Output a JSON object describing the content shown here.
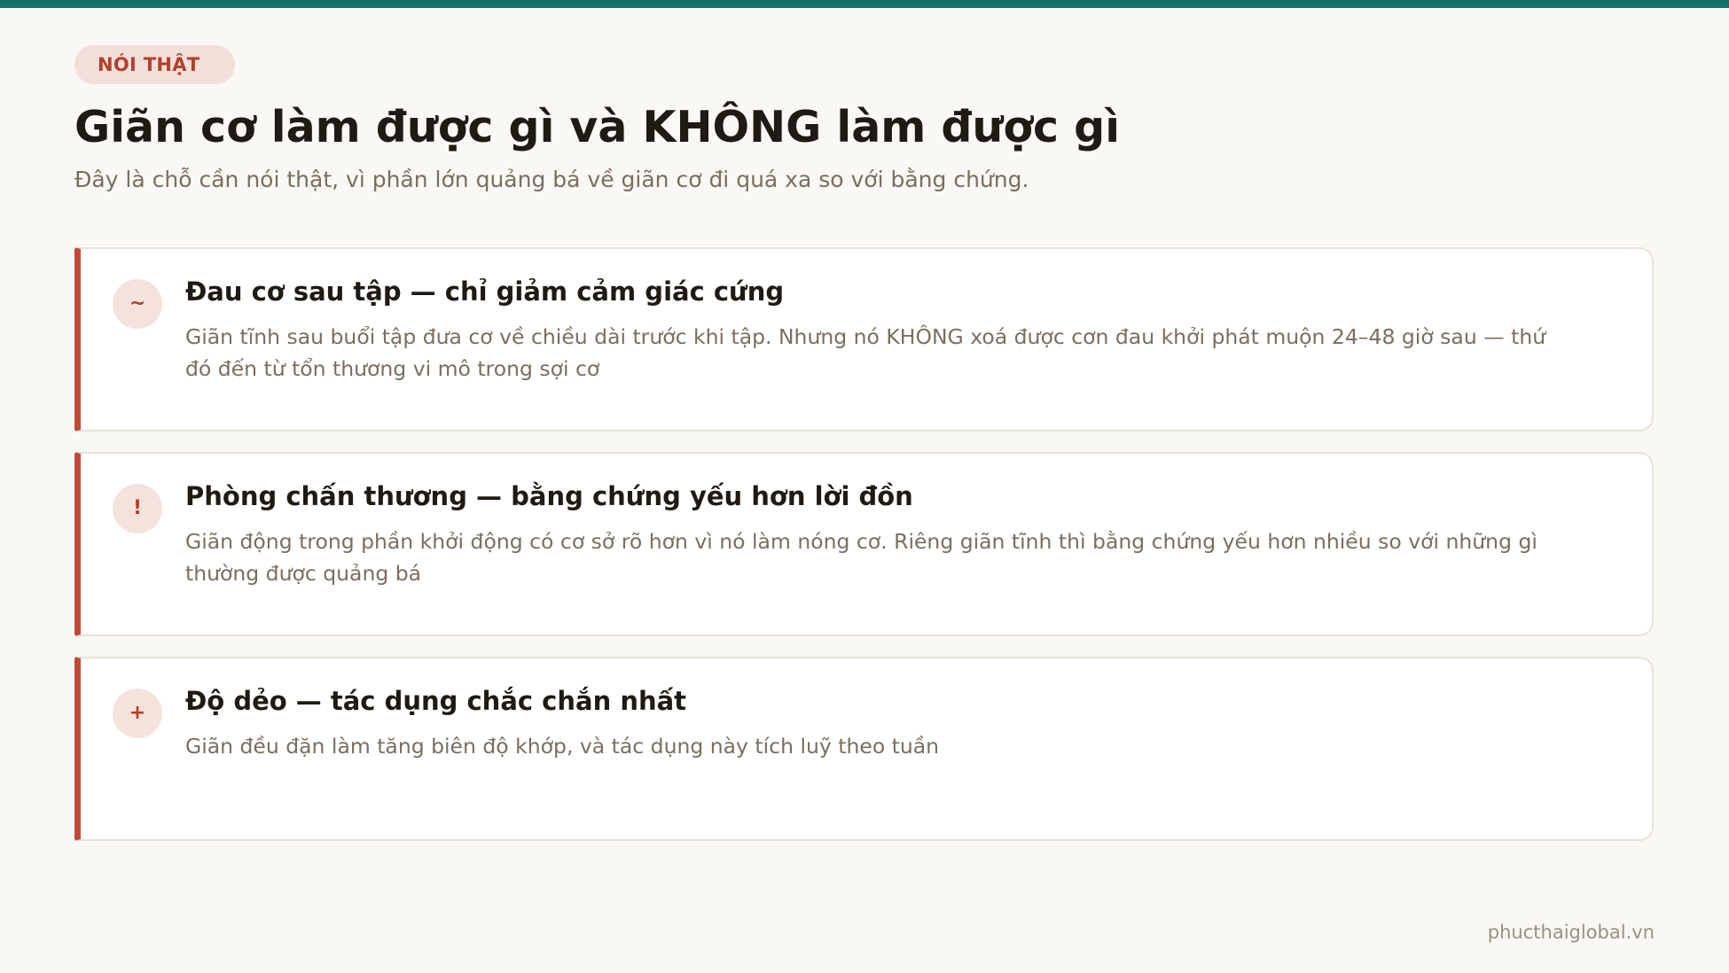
{
  "badge": "NÓI THẬT",
  "title": "Giãn cơ làm được gì và KHÔNG làm được gì",
  "subtitle": "Đây là chỗ cần nói thật, vì phần lớn quảng bá về giãn cơ đi quá xa so với bằng chứng.",
  "colors": {
    "accent": "#c24a35",
    "top_bar": "#17706a",
    "background": "#faf8f4",
    "badge_bg": "#f1dfd9"
  },
  "cards": [
    {
      "icon_glyph": "~",
      "icon_name": "wave-icon",
      "title": "Đau cơ sau tập — chỉ giảm cảm giác cứng",
      "text": "Giãn tĩnh sau buổi tập đưa cơ về chiều dài trước khi tập. Nhưng nó KHÔNG xoá được cơn đau khởi phát muộn 24–48 giờ sau — thứ đó đến từ tổn thương vi mô trong sợi cơ"
    },
    {
      "icon_glyph": "!",
      "icon_name": "exclamation-icon",
      "title": "Phòng chấn thương — bằng chứng yếu hơn lời đồn",
      "text": "Giãn động trong phần khởi động có cơ sở rõ hơn vì nó làm nóng cơ. Riêng giãn tĩnh thì bằng chứng yếu hơn nhiều so với những gì thường được quảng bá"
    },
    {
      "icon_glyph": "+",
      "icon_name": "plus-icon",
      "title": "Độ dẻo — tác dụng chắc chắn nhất",
      "text": "Giãn đều đặn làm tăng biên độ khớp, và tác dụng này tích luỹ theo tuần"
    }
  ],
  "footer": {
    "site": "phucthaiglobal.vn"
  }
}
